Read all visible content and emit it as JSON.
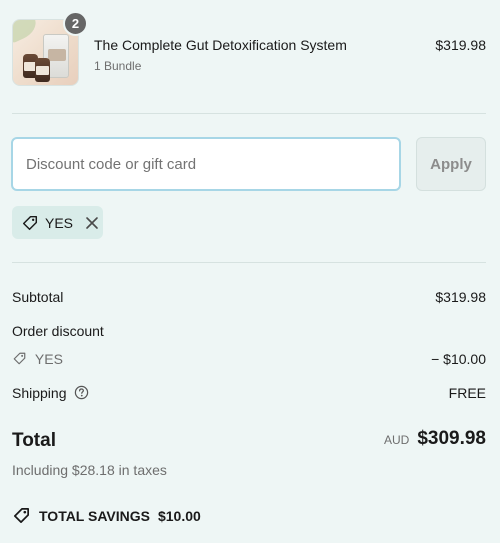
{
  "product": {
    "quantity": "2",
    "name": "The Complete Gut Detoxification System",
    "variant": "1 Bundle",
    "price": "$319.98"
  },
  "discount": {
    "placeholder": "Discount code or gift card",
    "value": "",
    "apply_label": "Apply",
    "applied_code": "YES"
  },
  "summary": {
    "subtotal_label": "Subtotal",
    "subtotal_value": "$319.98",
    "order_discount_label": "Order discount",
    "discount_code": "YES",
    "discount_value": "− $10.00",
    "shipping_label": "Shipping",
    "shipping_value": "FREE"
  },
  "total": {
    "label": "Total",
    "currency": "AUD",
    "amount": "$309.98",
    "taxes_note": "Including $28.18 in taxes"
  },
  "savings": {
    "label": "TOTAL SAVINGS",
    "amount": "$10.00"
  },
  "colors": {
    "background": "#eef6f5",
    "input_focus_border": "#a7d6e6",
    "tag_background": "#d9ece9"
  }
}
